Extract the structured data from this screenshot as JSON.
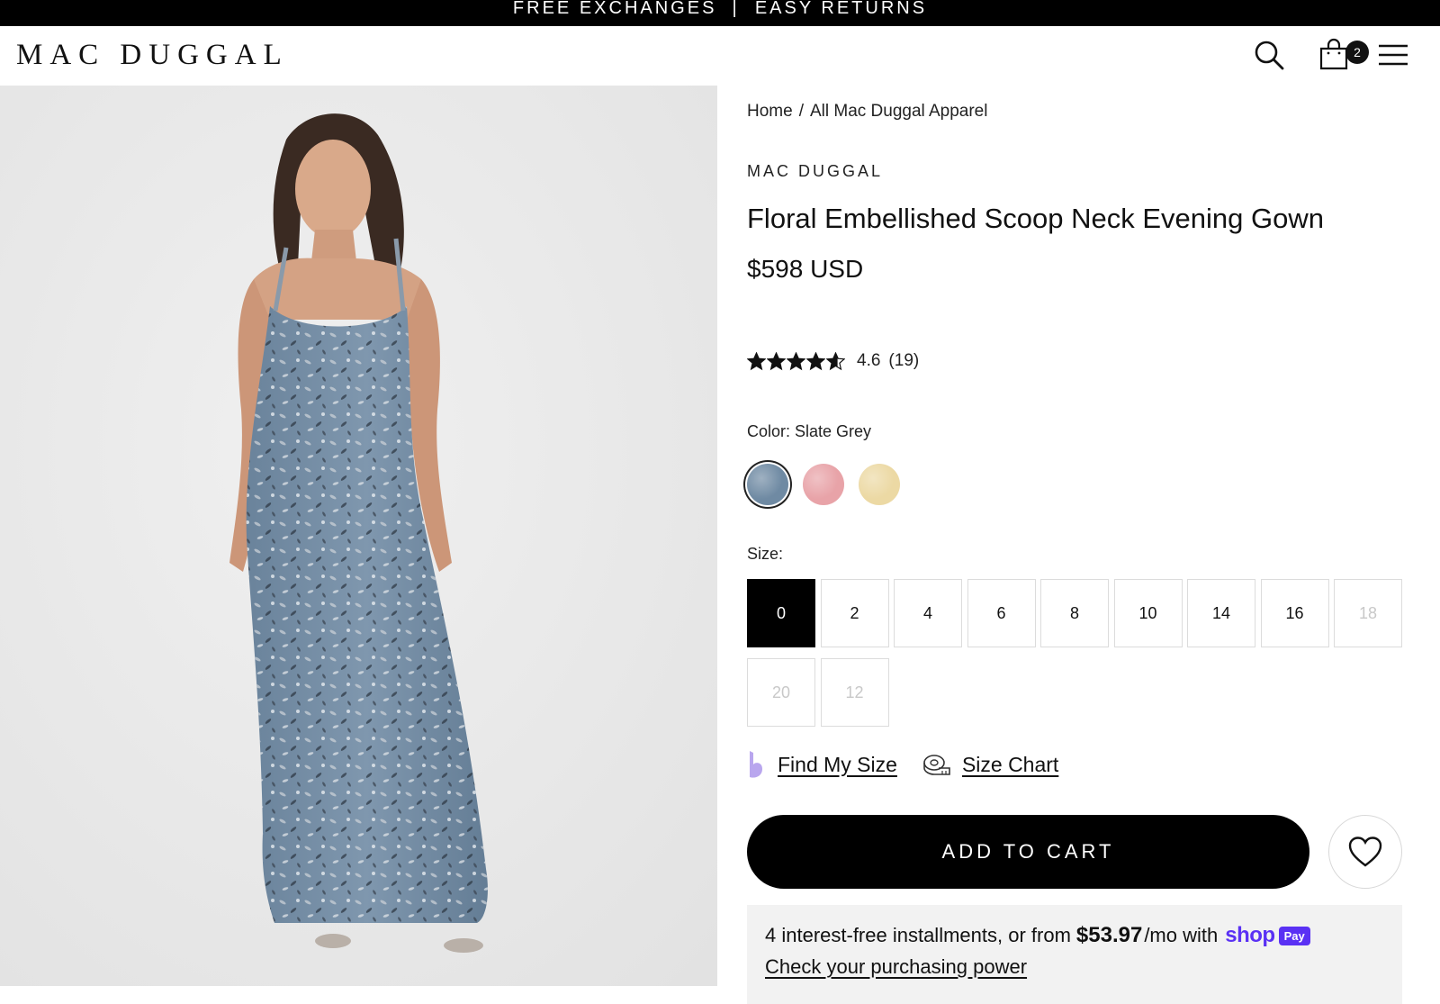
{
  "promo": {
    "text": "FREE EXCHANGES  |  EASY RETURNS"
  },
  "header": {
    "logo": "MAC DUGGAL",
    "cart_count": "2",
    "icons": [
      "search-icon",
      "shopping-bag-icon",
      "hamburger-menu-icon"
    ]
  },
  "breadcrumb": {
    "home": "Home",
    "separator": "/",
    "current": "All Mac Duggal Apparel"
  },
  "product": {
    "vendor": "MAC DUGGAL",
    "title": "Floral Embellished Scoop Neck Evening Gown",
    "price": "$598 USD",
    "rating": {
      "value": "4.6",
      "count": "(19)",
      "stars": 4.6
    },
    "color_label": "Color: Slate Grey",
    "swatches": [
      {
        "name": "Slate Grey",
        "color": "#6f8aa3",
        "selected": true
      },
      {
        "name": "Pink",
        "color": "#e8a3a8",
        "selected": false
      },
      {
        "name": "Yellow",
        "color": "#ecd9a4",
        "selected": false
      }
    ],
    "size_label": "Size:",
    "sizes": [
      {
        "label": "0",
        "state": "selected"
      },
      {
        "label": "2",
        "state": "available"
      },
      {
        "label": "4",
        "state": "available"
      },
      {
        "label": "6",
        "state": "available"
      },
      {
        "label": "8",
        "state": "available"
      },
      {
        "label": "10",
        "state": "available"
      },
      {
        "label": "14",
        "state": "available"
      },
      {
        "label": "16",
        "state": "available"
      },
      {
        "label": "18",
        "state": "disabled"
      },
      {
        "label": "20",
        "state": "disabled"
      },
      {
        "label": "12",
        "state": "disabled"
      }
    ],
    "find_my_size": "Find My Size",
    "size_chart": "Size Chart",
    "add_to_cart": "ADD TO CART"
  },
  "shop_pay": {
    "text_before": "4 interest-free installments, or from",
    "amount": "$53.97",
    "text_after": "/mo with",
    "logo_shop": "shop",
    "logo_pay": "Pay",
    "link": "Check your purchasing power"
  },
  "colors": {
    "accent": "#000000",
    "shop_pay_purple": "#5a31f4",
    "dress": "#7a93ab"
  }
}
